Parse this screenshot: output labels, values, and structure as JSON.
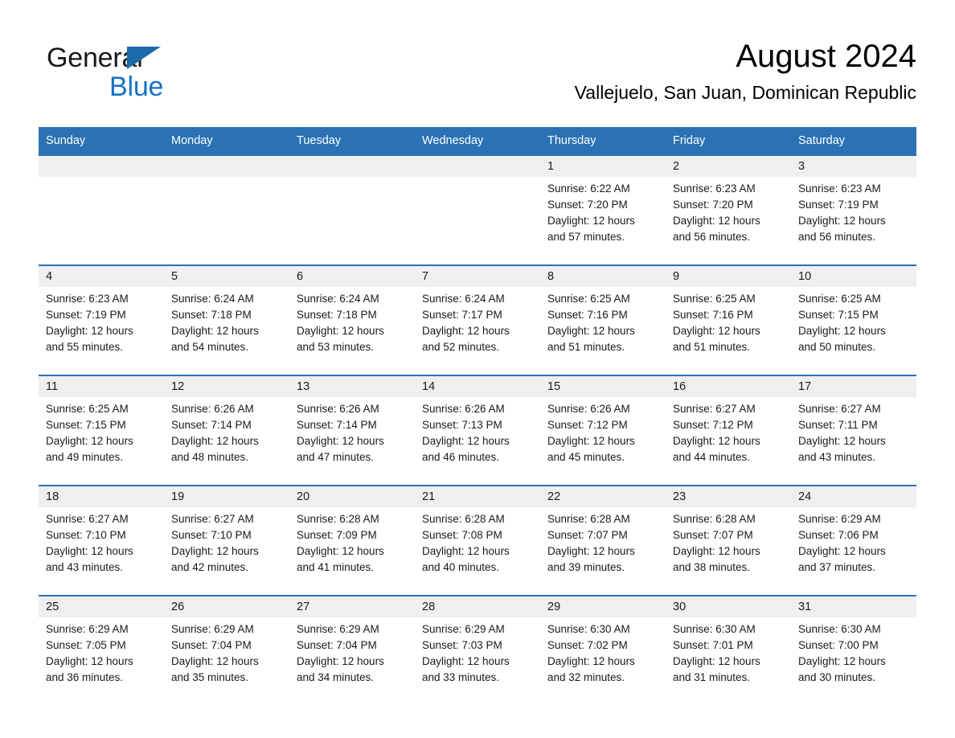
{
  "brand": {
    "name_part1": "General",
    "name_part2": "Blue",
    "triangle_color": "#1b6aab",
    "blue_color": "#1473c4"
  },
  "header": {
    "title": "August 2024",
    "subtitle": "Vallejuelo, San Juan, Dominican Republic",
    "accent_color": "#2a72b5",
    "daystrip_color": "#efefef"
  },
  "weekdays": [
    "Sunday",
    "Monday",
    "Tuesday",
    "Wednesday",
    "Thursday",
    "Friday",
    "Saturday"
  ],
  "weeks": [
    [
      {
        "day": "",
        "sunrise": "",
        "sunset": "",
        "daylight": ""
      },
      {
        "day": "",
        "sunrise": "",
        "sunset": "",
        "daylight": ""
      },
      {
        "day": "",
        "sunrise": "",
        "sunset": "",
        "daylight": ""
      },
      {
        "day": "",
        "sunrise": "",
        "sunset": "",
        "daylight": ""
      },
      {
        "day": "1",
        "sunrise": "Sunrise: 6:22 AM",
        "sunset": "Sunset: 7:20 PM",
        "daylight": "Daylight: 12 hours and 57 minutes."
      },
      {
        "day": "2",
        "sunrise": "Sunrise: 6:23 AM",
        "sunset": "Sunset: 7:20 PM",
        "daylight": "Daylight: 12 hours and 56 minutes."
      },
      {
        "day": "3",
        "sunrise": "Sunrise: 6:23 AM",
        "sunset": "Sunset: 7:19 PM",
        "daylight": "Daylight: 12 hours and 56 minutes."
      }
    ],
    [
      {
        "day": "4",
        "sunrise": "Sunrise: 6:23 AM",
        "sunset": "Sunset: 7:19 PM",
        "daylight": "Daylight: 12 hours and 55 minutes."
      },
      {
        "day": "5",
        "sunrise": "Sunrise: 6:24 AM",
        "sunset": "Sunset: 7:18 PM",
        "daylight": "Daylight: 12 hours and 54 minutes."
      },
      {
        "day": "6",
        "sunrise": "Sunrise: 6:24 AM",
        "sunset": "Sunset: 7:18 PM",
        "daylight": "Daylight: 12 hours and 53 minutes."
      },
      {
        "day": "7",
        "sunrise": "Sunrise: 6:24 AM",
        "sunset": "Sunset: 7:17 PM",
        "daylight": "Daylight: 12 hours and 52 minutes."
      },
      {
        "day": "8",
        "sunrise": "Sunrise: 6:25 AM",
        "sunset": "Sunset: 7:16 PM",
        "daylight": "Daylight: 12 hours and 51 minutes."
      },
      {
        "day": "9",
        "sunrise": "Sunrise: 6:25 AM",
        "sunset": "Sunset: 7:16 PM",
        "daylight": "Daylight: 12 hours and 51 minutes."
      },
      {
        "day": "10",
        "sunrise": "Sunrise: 6:25 AM",
        "sunset": "Sunset: 7:15 PM",
        "daylight": "Daylight: 12 hours and 50 minutes."
      }
    ],
    [
      {
        "day": "11",
        "sunrise": "Sunrise: 6:25 AM",
        "sunset": "Sunset: 7:15 PM",
        "daylight": "Daylight: 12 hours and 49 minutes."
      },
      {
        "day": "12",
        "sunrise": "Sunrise: 6:26 AM",
        "sunset": "Sunset: 7:14 PM",
        "daylight": "Daylight: 12 hours and 48 minutes."
      },
      {
        "day": "13",
        "sunrise": "Sunrise: 6:26 AM",
        "sunset": "Sunset: 7:14 PM",
        "daylight": "Daylight: 12 hours and 47 minutes."
      },
      {
        "day": "14",
        "sunrise": "Sunrise: 6:26 AM",
        "sunset": "Sunset: 7:13 PM",
        "daylight": "Daylight: 12 hours and 46 minutes."
      },
      {
        "day": "15",
        "sunrise": "Sunrise: 6:26 AM",
        "sunset": "Sunset: 7:12 PM",
        "daylight": "Daylight: 12 hours and 45 minutes."
      },
      {
        "day": "16",
        "sunrise": "Sunrise: 6:27 AM",
        "sunset": "Sunset: 7:12 PM",
        "daylight": "Daylight: 12 hours and 44 minutes."
      },
      {
        "day": "17",
        "sunrise": "Sunrise: 6:27 AM",
        "sunset": "Sunset: 7:11 PM",
        "daylight": "Daylight: 12 hours and 43 minutes."
      }
    ],
    [
      {
        "day": "18",
        "sunrise": "Sunrise: 6:27 AM",
        "sunset": "Sunset: 7:10 PM",
        "daylight": "Daylight: 12 hours and 43 minutes."
      },
      {
        "day": "19",
        "sunrise": "Sunrise: 6:27 AM",
        "sunset": "Sunset: 7:10 PM",
        "daylight": "Daylight: 12 hours and 42 minutes."
      },
      {
        "day": "20",
        "sunrise": "Sunrise: 6:28 AM",
        "sunset": "Sunset: 7:09 PM",
        "daylight": "Daylight: 12 hours and 41 minutes."
      },
      {
        "day": "21",
        "sunrise": "Sunrise: 6:28 AM",
        "sunset": "Sunset: 7:08 PM",
        "daylight": "Daylight: 12 hours and 40 minutes."
      },
      {
        "day": "22",
        "sunrise": "Sunrise: 6:28 AM",
        "sunset": "Sunset: 7:07 PM",
        "daylight": "Daylight: 12 hours and 39 minutes."
      },
      {
        "day": "23",
        "sunrise": "Sunrise: 6:28 AM",
        "sunset": "Sunset: 7:07 PM",
        "daylight": "Daylight: 12 hours and 38 minutes."
      },
      {
        "day": "24",
        "sunrise": "Sunrise: 6:29 AM",
        "sunset": "Sunset: 7:06 PM",
        "daylight": "Daylight: 12 hours and 37 minutes."
      }
    ],
    [
      {
        "day": "25",
        "sunrise": "Sunrise: 6:29 AM",
        "sunset": "Sunset: 7:05 PM",
        "daylight": "Daylight: 12 hours and 36 minutes."
      },
      {
        "day": "26",
        "sunrise": "Sunrise: 6:29 AM",
        "sunset": "Sunset: 7:04 PM",
        "daylight": "Daylight: 12 hours and 35 minutes."
      },
      {
        "day": "27",
        "sunrise": "Sunrise: 6:29 AM",
        "sunset": "Sunset: 7:04 PM",
        "daylight": "Daylight: 12 hours and 34 minutes."
      },
      {
        "day": "28",
        "sunrise": "Sunrise: 6:29 AM",
        "sunset": "Sunset: 7:03 PM",
        "daylight": "Daylight: 12 hours and 33 minutes."
      },
      {
        "day": "29",
        "sunrise": "Sunrise: 6:30 AM",
        "sunset": "Sunset: 7:02 PM",
        "daylight": "Daylight: 12 hours and 32 minutes."
      },
      {
        "day": "30",
        "sunrise": "Sunrise: 6:30 AM",
        "sunset": "Sunset: 7:01 PM",
        "daylight": "Daylight: 12 hours and 31 minutes."
      },
      {
        "day": "31",
        "sunrise": "Sunrise: 6:30 AM",
        "sunset": "Sunset: 7:00 PM",
        "daylight": "Daylight: 12 hours and 30 minutes."
      }
    ]
  ]
}
